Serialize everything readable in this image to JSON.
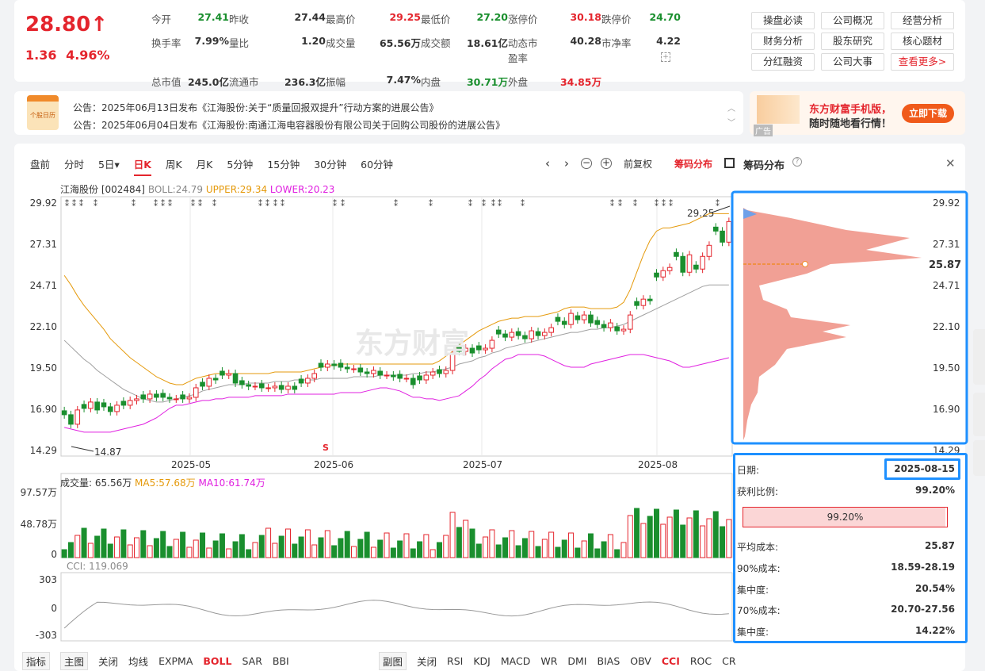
{
  "quote": {
    "price": "28.80↑",
    "change": "1.36",
    "change_pct": "4.96%",
    "fields": [
      [
        "今开",
        "27.41",
        "g"
      ],
      [
        "昨收",
        "27.44",
        ""
      ],
      [
        "最高价",
        "29.25",
        "r"
      ],
      [
        "最低价",
        "27.20",
        "g"
      ],
      [
        "涨停价",
        "30.18",
        "r"
      ],
      [
        "跌停价",
        "24.70",
        "g"
      ],
      [
        "换手率",
        "7.99%",
        ""
      ],
      [
        "量比",
        "1.20",
        ""
      ],
      [
        "成交量",
        "65.56万",
        ""
      ],
      [
        "成交额",
        "18.61亿",
        ""
      ],
      [
        "动态市盈率",
        "40.28",
        ""
      ],
      [
        "市净率",
        "4.22",
        ""
      ],
      [
        "总市值",
        "245.0亿",
        ""
      ],
      [
        "流通市值",
        "236.3亿",
        ""
      ],
      [
        "振幅",
        "7.47%",
        ""
      ],
      [
        "内盘",
        "30.71万",
        "g"
      ],
      [
        "外盘",
        "34.85万",
        "r"
      ],
      [
        "",
        "",
        " "
      ]
    ]
  },
  "side_buttons": [
    "操盘必读",
    "公司概况",
    "经营分析",
    "财务分析",
    "股东研究",
    "核心题材",
    "分红融资",
    "公司大事",
    "查看更多>"
  ],
  "notices": {
    "icon_text": "个股日历",
    "items": [
      "公告：2025年06月13日发布《江海股份:关于“质量回报双提升”行动方案的进展公告》",
      "公告：2025年06月04日发布《江海股份:南通江海电容器股份有限公司关于回购公司股份的进展公告》"
    ]
  },
  "ad": {
    "tag": "广告",
    "line1": "东方财富手机版，",
    "line2": "随时随地看行情！",
    "button": "立即下载"
  },
  "chart_tabs": [
    "盘前",
    "分时",
    "5日▾",
    "日K",
    "周K",
    "月K",
    "5分钟",
    "15分钟",
    "30分钟",
    "60分钟"
  ],
  "chart_tabs_active": "日K",
  "toolbar": {
    "fuquan": "前复权",
    "chips_toggle": "筹码分布",
    "chips_title": "筹码分布"
  },
  "legend": {
    "name": "江海股份 [002484]",
    "boll": "BOLL:24.79",
    "upper": "UPPER:29.34",
    "lower": "LOWER:20.23"
  },
  "price_axis": [
    "29.92",
    "27.31",
    "24.71",
    "22.10",
    "19.50",
    "16.90",
    "14.29"
  ],
  "date_axis": [
    "2025-05",
    "2025-06",
    "2025-07",
    "2025-08"
  ],
  "annotations": {
    "high": "29.25",
    "low": "14.87",
    "watermark": "东方财富",
    "s_marker": "S"
  },
  "chips_axis": [
    "29.92",
    "27.31",
    "24.71",
    "22.10",
    "19.50",
    "16.90",
    "14.29"
  ],
  "chips_avg_label": "25.87",
  "volume": {
    "legend": "成交量: 65.56万",
    "ma5": "MA5:57.68万",
    "ma10": "MA10:61.74万",
    "axis": [
      "97.57万",
      "48.78万",
      "0"
    ]
  },
  "cci": {
    "legend": "CCI: 119.069",
    "axis": [
      "303",
      "0",
      "-303"
    ]
  },
  "chip_info": {
    "date_label": "日期:",
    "date": "2025-08-15",
    "profit_label": "获利比例:",
    "profit": "99.20%",
    "bar_value": "99.20%",
    "bar_fraction": 0.992,
    "rows": [
      [
        "平均成本:",
        "25.87"
      ],
      [
        "90%成本:",
        "18.59-28.19"
      ],
      [
        "集中度:",
        "20.54%"
      ],
      [
        "70%成本:",
        "20.70-27.56"
      ],
      [
        "集中度:",
        "14.22%"
      ]
    ]
  },
  "bottom_left": [
    "指标",
    "主图",
    "关闭",
    "均线",
    "EXPMA",
    "BOLL",
    "SAR",
    "BBI"
  ],
  "bottom_left_active": "BOLL",
  "bottom_right": [
    "副图",
    "关闭",
    "RSI",
    "KDJ",
    "MACD",
    "WR",
    "DMI",
    "BIAS",
    "OBV",
    "CCI",
    "ROC",
    "CR"
  ],
  "bottom_right_active": "CCI",
  "colors": {
    "up": "#e4252d",
    "down": "#1a8f2e",
    "upper": "#e59a0c",
    "lower": "#e020e0",
    "mid": "#a0a0a0",
    "highlight": "#1e90ff"
  },
  "chart_data": {
    "type": "candlestick",
    "close": [
      16.6,
      16.0,
      16.9,
      17.0,
      17.4,
      16.9,
      17.1,
      16.8,
      17.2,
      17.2,
      17.5,
      17.6,
      17.6,
      17.9,
      17.7,
      17.7,
      17.6,
      17.6,
      17.6,
      17.7,
      18.3,
      18.4,
      18.9,
      18.8,
      19.1,
      19.2,
      18.6,
      18.5,
      18.4,
      18.4,
      18.3,
      18.3,
      18.4,
      18.2,
      18.4,
      18.2,
      18.6,
      18.9,
      19.2,
      19.6,
      19.8,
      19.7,
      19.6,
      19.5,
      19.5,
      19.3,
      19.2,
      19.4,
      19.1,
      19.1,
      19.0,
      18.9,
      18.9,
      18.5,
      18.8,
      19.1,
      19.3,
      19.2,
      19.4,
      20.4,
      20.6,
      20.8,
      20.5,
      20.7,
      20.8,
      21.3,
      21.7,
      21.5,
      21.8,
      21.6,
      21.4,
      21.9,
      21.6,
      21.8,
      22.1,
      22.5,
      22.3,
      23.0,
      22.6,
      22.9,
      22.4,
      22.3,
      22.1,
      22.4,
      21.9,
      22.0,
      22.9,
      23.5,
      23.9,
      23.8,
      25.3,
      25.7,
      25.9,
      26.6,
      25.6,
      26.7,
      25.8,
      26.6,
      27.3,
      28.2,
      27.5,
      28.8
    ],
    "upper_band": [
      25.4,
      24.8,
      24.1,
      23.5,
      23.0,
      22.5,
      22.0,
      21.4,
      21.0,
      20.6,
      20.2,
      19.9,
      19.6,
      19.3,
      19.0,
      18.8,
      18.6,
      18.5,
      18.5,
      18.7,
      18.9,
      19.0,
      19.1,
      19.2,
      19.2,
      19.2,
      19.2,
      19.2,
      19.2,
      19.2,
      19.2,
      19.2,
      19.3,
      19.3,
      19.3,
      19.3,
      19.3,
      19.4,
      19.5,
      19.6,
      19.7,
      19.7,
      19.8,
      19.8,
      19.8,
      19.8,
      19.8,
      19.8,
      19.8,
      19.8,
      19.8,
      19.8,
      19.8,
      19.8,
      19.8,
      19.8,
      19.8,
      20.0,
      20.3,
      20.6,
      21.0,
      21.3,
      21.6,
      21.9,
      22.1,
      22.3,
      22.5,
      22.6,
      22.7,
      22.7,
      22.8,
      22.8,
      22.8,
      22.9,
      23.0,
      23.1,
      23.3,
      23.4,
      23.4,
      23.4,
      23.3,
      23.3,
      23.3,
      23.3,
      23.4,
      23.7,
      24.5,
      25.6,
      26.7,
      27.6,
      28.2,
      28.4,
      28.4,
      28.5,
      28.6,
      28.7,
      28.9,
      29.1,
      29.3,
      29.3,
      29.3,
      29.3
    ],
    "mid_band": [
      21.3,
      20.9,
      20.5,
      20.1,
      19.8,
      19.4,
      19.1,
      18.8,
      18.5,
      18.2,
      18.0,
      17.8,
      17.6,
      17.5,
      17.4,
      17.4,
      17.5,
      17.6,
      17.7,
      17.8,
      17.9,
      18.1,
      18.2,
      18.3,
      18.4,
      18.5,
      18.5,
      18.5,
      18.6,
      18.6,
      18.6,
      18.6,
      18.7,
      18.7,
      18.7,
      18.8,
      18.8,
      18.8,
      18.8,
      18.9,
      18.9,
      18.9,
      18.9,
      18.9,
      19.0,
      19.0,
      19.0,
      19.0,
      19.1,
      19.1,
      19.1,
      19.1,
      19.1,
      19.2,
      19.2,
      19.3,
      19.3,
      19.4,
      19.5,
      19.6,
      19.8,
      19.9,
      20.0,
      20.2,
      20.3,
      20.5,
      20.6,
      20.8,
      20.9,
      21.0,
      21.1,
      21.2,
      21.3,
      21.4,
      21.5,
      21.6,
      21.7,
      21.8,
      21.8,
      21.9,
      22.0,
      22.0,
      22.1,
      22.1,
      22.2,
      22.3,
      22.5,
      22.7,
      22.9,
      23.1,
      23.3,
      23.5,
      23.7,
      23.9,
      24.1,
      24.3,
      24.5,
      24.7,
      24.8,
      24.8,
      24.8,
      24.8
    ],
    "lower_band": [
      15.8,
      15.7,
      15.6,
      15.5,
      15.5,
      15.5,
      15.5,
      15.5,
      15.6,
      15.7,
      15.8,
      15.9,
      16.0,
      16.2,
      16.4,
      16.7,
      17.0,
      17.2,
      17.2,
      17.3,
      17.4,
      17.5,
      17.5,
      17.6,
      17.6,
      17.7,
      17.7,
      17.7,
      17.7,
      17.8,
      17.8,
      17.8,
      17.8,
      17.8,
      17.9,
      17.9,
      17.9,
      17.9,
      17.9,
      17.9,
      17.9,
      17.9,
      18.0,
      18.0,
      18.0,
      18.0,
      18.1,
      18.2,
      18.3,
      18.3,
      18.2,
      18.1,
      17.9,
      17.7,
      17.7,
      17.6,
      17.6,
      17.5,
      17.6,
      17.7,
      17.8,
      18.1,
      18.4,
      18.8,
      19.1,
      19.5,
      19.8,
      20.1,
      20.2,
      20.4,
      20.4,
      20.4,
      20.4,
      20.3,
      20.1,
      19.9,
      19.7,
      19.6,
      19.6,
      19.6,
      19.8,
      19.9,
      20.0,
      20.1,
      20.2,
      20.3,
      20.4,
      20.4,
      20.4,
      20.3,
      20.2,
      20.1,
      20.0,
      19.8,
      19.6,
      19.6,
      19.7,
      19.8,
      19.9,
      20.0,
      20.1,
      20.2
    ],
    "ylim": [
      14.29,
      29.92
    ]
  }
}
